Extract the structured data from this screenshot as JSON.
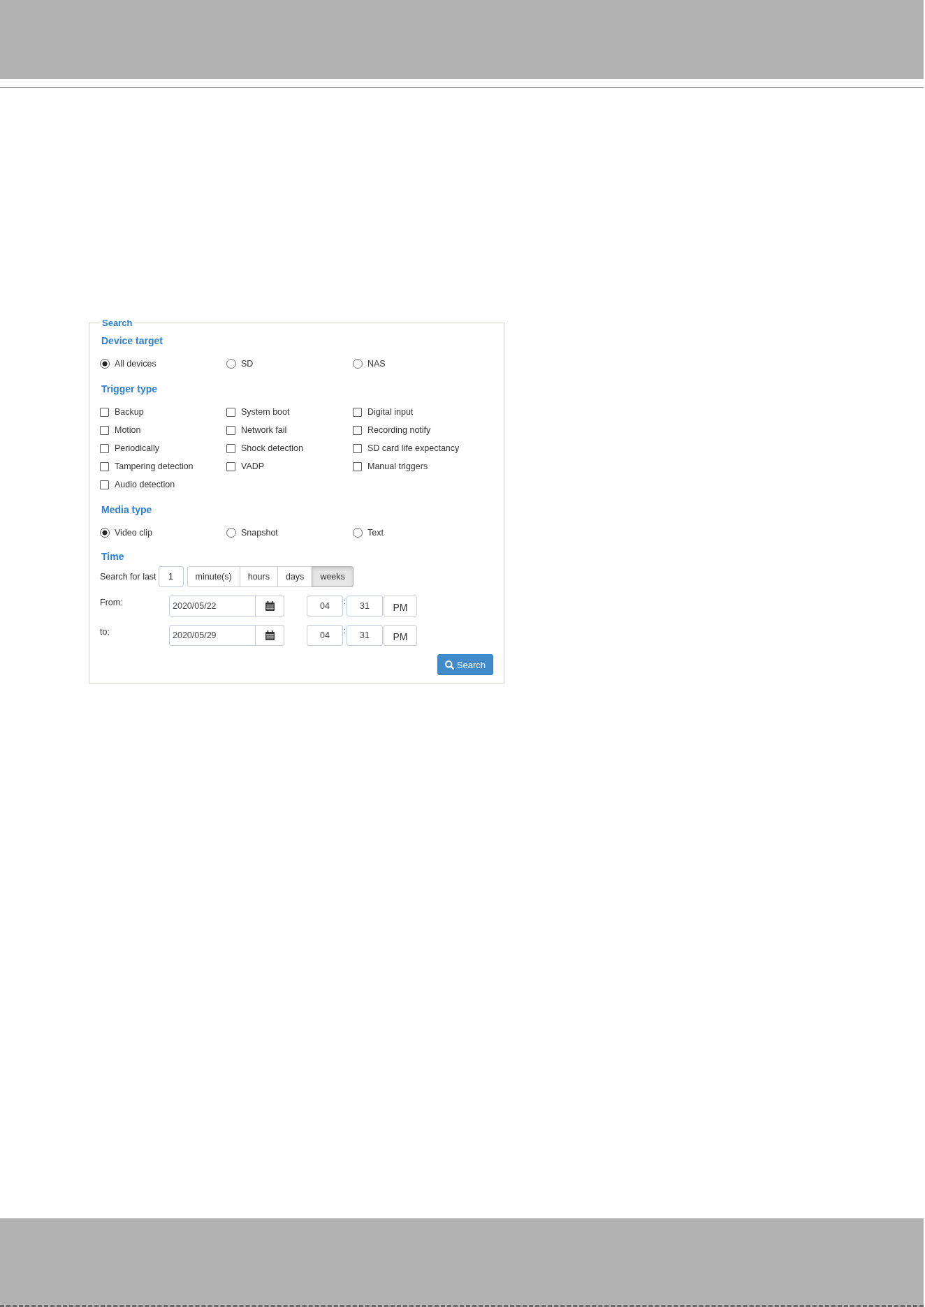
{
  "search_panel": {
    "title": "Search",
    "sections": [
      {
        "kind": "radio",
        "heading": "Device target",
        "options": [
          {
            "label": "All devices",
            "selected": true
          },
          {
            "label": "SD",
            "selected": false
          },
          {
            "label": "NAS",
            "selected": false
          }
        ]
      },
      {
        "kind": "checkbox",
        "heading": "Trigger type",
        "options": [
          {
            "label": "Backup",
            "checked": false
          },
          {
            "label": "System boot",
            "checked": false
          },
          {
            "label": "Digital input",
            "checked": false
          },
          {
            "label": "Motion",
            "checked": false
          },
          {
            "label": "Network fail",
            "checked": false
          },
          {
            "label": "Recording notify",
            "checked": false
          },
          {
            "label": "Periodically",
            "checked": false
          },
          {
            "label": "Shock detection",
            "checked": false
          },
          {
            "label": "SD card life expectancy",
            "checked": false
          },
          {
            "label": "Tampering detection",
            "checked": false
          },
          {
            "label": "VADP",
            "checked": false
          },
          {
            "label": "Manual triggers",
            "checked": false
          },
          {
            "label": "Audio detection",
            "checked": false
          }
        ]
      },
      {
        "kind": "radio",
        "heading": "Media type",
        "options": [
          {
            "label": "Video clip",
            "selected": true
          },
          {
            "label": "Snapshot",
            "selected": false
          },
          {
            "label": "Text",
            "selected": false
          }
        ]
      },
      {
        "kind": "time",
        "heading": "Time",
        "search_for_last": {
          "label": "Search for last",
          "value": "1",
          "units": [
            {
              "label": "minute(s)",
              "selected": false
            },
            {
              "label": "hours",
              "selected": false
            },
            {
              "label": "days",
              "selected": false
            },
            {
              "label": "weeks",
              "selected": true
            }
          ]
        },
        "ranges": [
          {
            "label": "From:",
            "date": "2020/05/22",
            "hour": "04",
            "separator": ":",
            "minute": "31",
            "period": "PM"
          },
          {
            "label": "to:",
            "date": "2020/05/29",
            "hour": "04",
            "separator": ":",
            "minute": "31",
            "period": "PM"
          }
        ]
      }
    ],
    "search_button": {
      "label": "Search"
    }
  }
}
